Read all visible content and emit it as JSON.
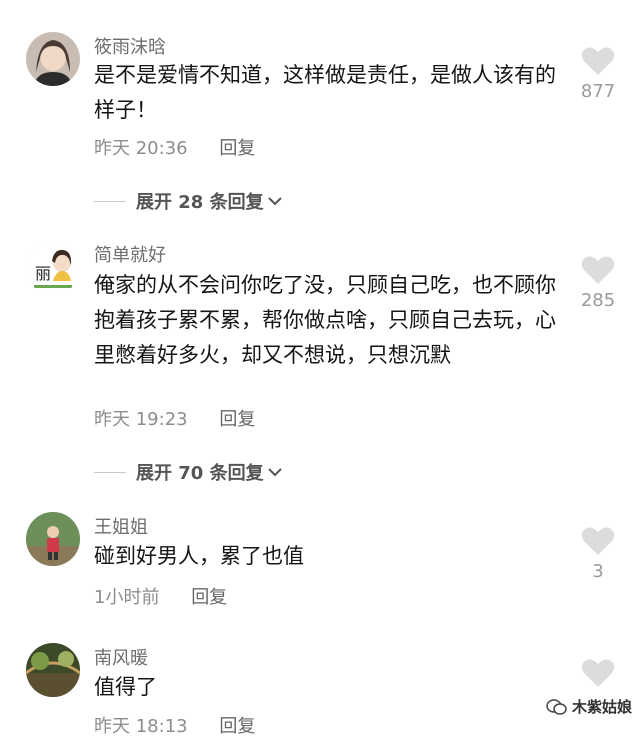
{
  "comments": [
    {
      "username": "筱雨沫晗",
      "text": "是不是爱情不知道，这样做是责任，是做人该有的样子！",
      "time": "昨天 20:36",
      "reply_label": "回复",
      "likes": "877",
      "expand_label": "展开 28 条回复"
    },
    {
      "username": "简单就好",
      "text": "俺家的从不会问你吃了没，只顾自己吃，也不顾你抱着孩子累不累，帮你做点啥，只顾自己去玩，心里憋着好多火，却又不想说，只想沉默",
      "time": "昨天 19:23",
      "reply_label": "回复",
      "likes": "285",
      "expand_label": "展开 70 条回复",
      "avatar_text": "丽"
    },
    {
      "username": "王姐姐",
      "text": "碰到好男人，累了也值",
      "time": "1小时前",
      "reply_label": "回复",
      "likes": "3"
    },
    {
      "username": "南风暖",
      "text": "值得了",
      "time": "昨天 18:13",
      "reply_label": "回复",
      "likes": ""
    }
  ],
  "watermark": "木紫姑娘",
  "colors": {
    "heart": "#dcdcdc",
    "username": "#6e6e6e",
    "meta": "#8d8d8d"
  }
}
